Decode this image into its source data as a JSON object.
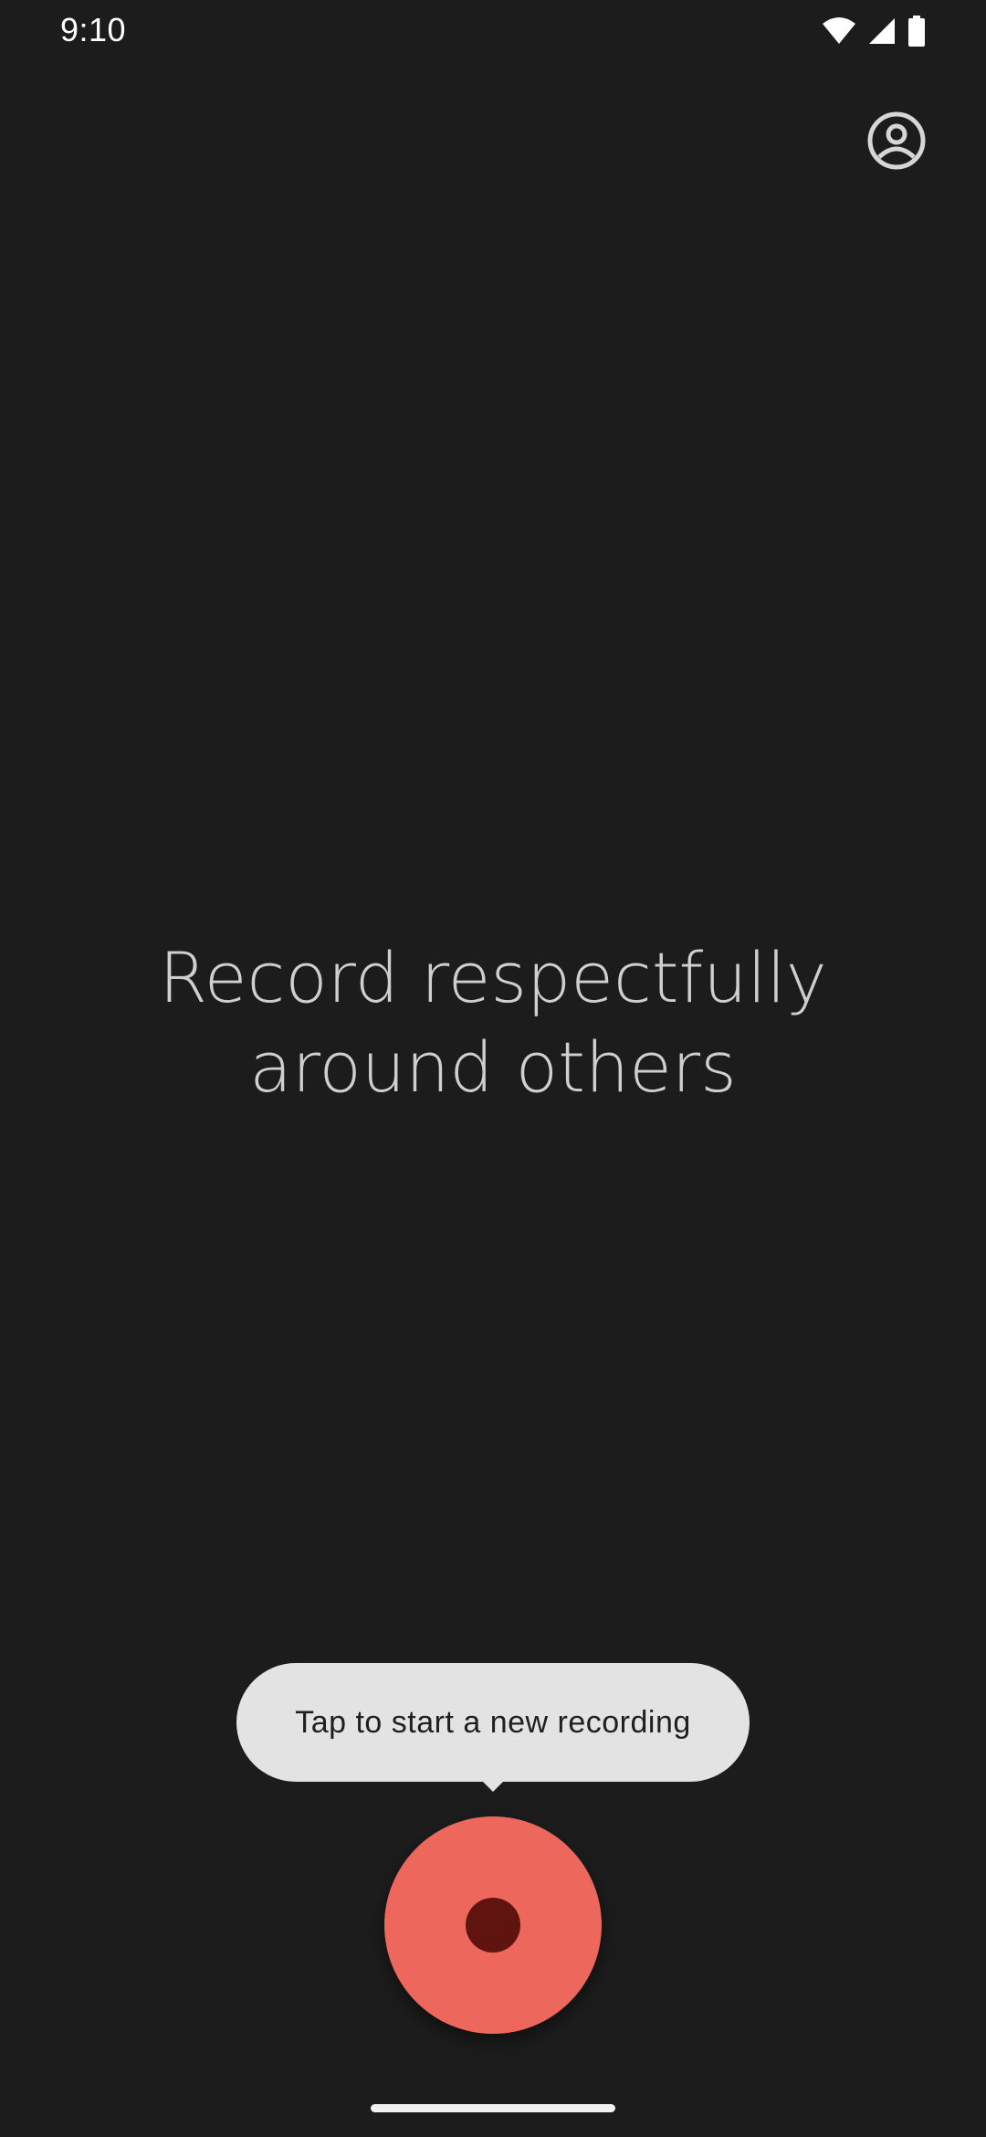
{
  "status_bar": {
    "time": "9:10",
    "icons": [
      "wifi-icon",
      "cellular-signal-icon",
      "battery-icon"
    ]
  },
  "header": {
    "account_icon": "account-circle-icon"
  },
  "main": {
    "headline": "Record respectfully around others"
  },
  "tooltip": {
    "text": "Tap to start a new recording"
  },
  "record_button": {
    "icon": "record-dot-icon"
  },
  "colors": {
    "background": "#1c1c1c",
    "headline_text": "#cfcfcf",
    "tooltip_bg": "#e3e3e3",
    "record_button": "#ee675c",
    "record_dot": "#601410"
  }
}
